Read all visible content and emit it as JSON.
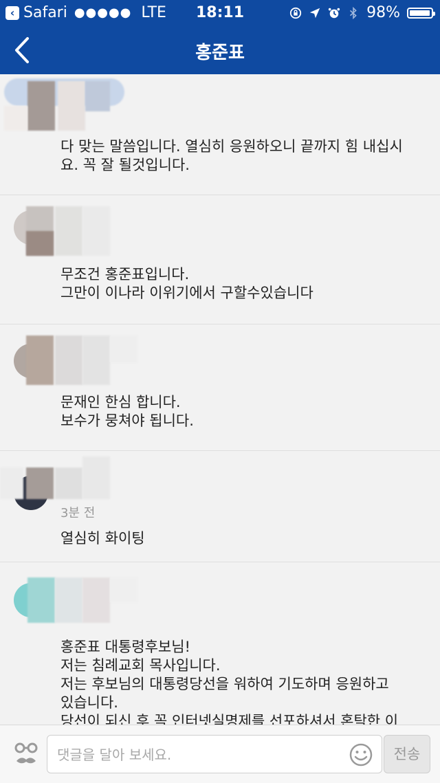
{
  "status_bar": {
    "app": "Safari",
    "signal": "●●●●●",
    "network": "LTE",
    "time": "18:11",
    "battery": "98%",
    "battery_level": 0.98
  },
  "nav": {
    "title": "홍준표"
  },
  "comments": [
    {
      "time": "",
      "text": "다 맞는 말씀입니다. 열심히 응원하오니 끝까지 힘 내십시\n요. 꼭 잘 될것입니다."
    },
    {
      "time": "",
      "text": "무조건 홍준표입니다.\n그만이 이나라 이위기에서 구할수있습니다"
    },
    {
      "time": "",
      "text": "문재인 한심 합니다.\n보수가 뭉쳐야 됩니다."
    },
    {
      "time": "3분 전",
      "text": "열심히 화이팅"
    },
    {
      "time": "",
      "text": "홍준표 대통령후보님!\n저는 침례교회 목사입니다.\n저는 후보님의 대통령당선을 워하여 기도하며 응원하고\n있습니다.\n당선이 되신 후 꼭 인터넷실명제를 선포하셔서 혼탁한 이"
    }
  ],
  "input_bar": {
    "placeholder": "댓글을 달아 보세요.",
    "send_label": "전송"
  },
  "colors": {
    "header": "#0f4aa1",
    "background": "#f2f2f2"
  }
}
